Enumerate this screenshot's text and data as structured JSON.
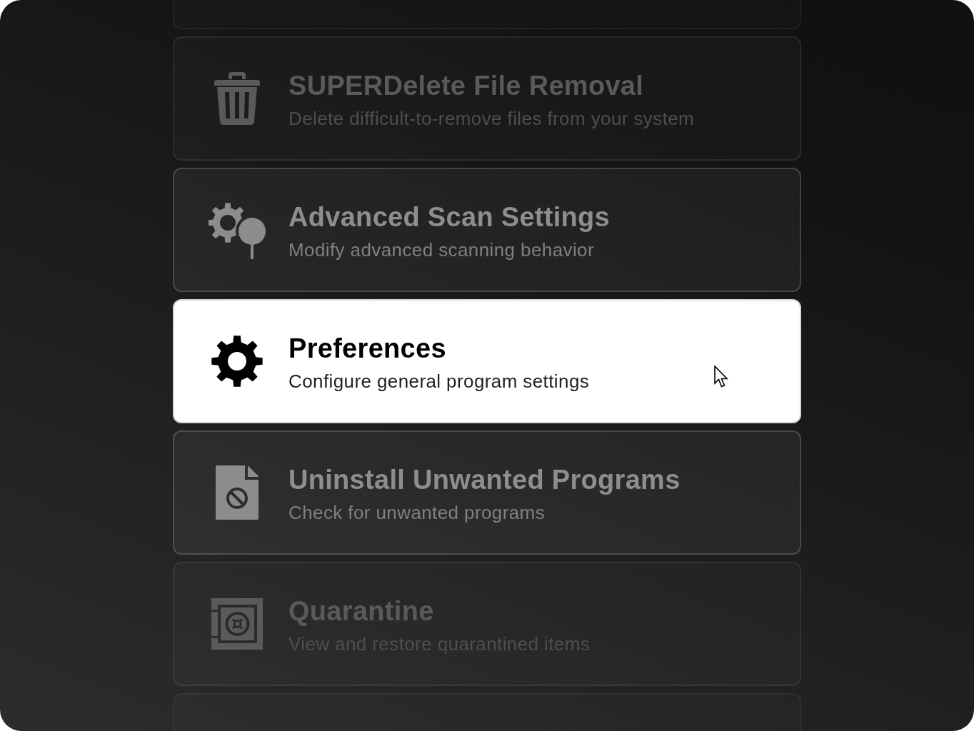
{
  "menu": {
    "more_above": true,
    "items": [
      {
        "kind": "trash",
        "title": "SUPERDelete File Removal",
        "description": "Delete difficult-to-remove files from your system",
        "selected": false
      },
      {
        "kind": "scan",
        "title": "Advanced Scan Settings",
        "description": "Modify advanced scanning behavior",
        "selected": false
      },
      {
        "kind": "gear",
        "title": "Preferences",
        "description": "Configure general program settings",
        "selected": true
      },
      {
        "kind": "blocked",
        "title": "Uninstall Unwanted Programs",
        "description": "Check for unwanted programs",
        "selected": false
      },
      {
        "kind": "safe",
        "title": "Quarantine",
        "description": "View and restore quarantined items",
        "selected": false
      }
    ],
    "more_below": true
  }
}
